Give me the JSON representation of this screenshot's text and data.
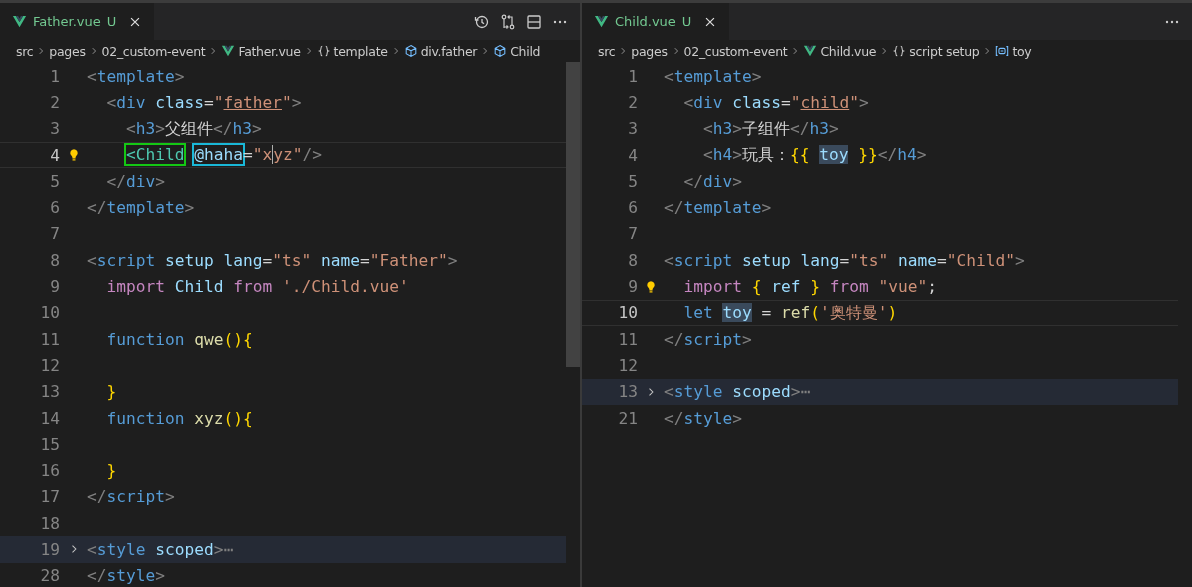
{
  "editors": [
    {
      "tab": {
        "label": "Father.vue",
        "status": "U",
        "selected": true
      },
      "toolbar": [
        {
          "kind": "history"
        },
        {
          "kind": "compare"
        },
        {
          "kind": "split"
        },
        {
          "kind": "more"
        }
      ],
      "breadcrumbs": [
        {
          "label": "src",
          "kind": "folder"
        },
        {
          "label": "pages",
          "kind": "folder"
        },
        {
          "label": "02_custom-event",
          "kind": "folder"
        },
        {
          "label": "Father.vue",
          "kind": "vue"
        },
        {
          "label": "template",
          "kind": "braces"
        },
        {
          "label": "div.father",
          "kind": "element"
        },
        {
          "label": "Child",
          "kind": "element"
        }
      ],
      "lines": [
        {
          "n": "1",
          "tokens": [
            {
              "t": "<",
              "kind": "punct"
            },
            {
              "t": "template",
              "kind": "tag"
            },
            {
              "t": ">",
              "kind": "punct"
            }
          ]
        },
        {
          "n": "2",
          "tokens": [
            {
              "t": "  <",
              "kind": "punct"
            },
            {
              "t": "div",
              "kind": "tag"
            },
            {
              "t": " class",
              "kind": "attr"
            },
            {
              "t": "=",
              "kind": "text"
            },
            {
              "t": "\"",
              "kind": "str"
            },
            {
              "t": "father",
              "kind": "str",
              "underline": true
            },
            {
              "t": "\"",
              "kind": "str"
            },
            {
              "t": ">",
              "kind": "punct"
            }
          ]
        },
        {
          "n": "3",
          "tokens": [
            {
              "t": "    <",
              "kind": "punct"
            },
            {
              "t": "h3",
              "kind": "tag"
            },
            {
              "t": ">",
              "kind": "punct"
            },
            {
              "t": "父组件",
              "kind": "text"
            },
            {
              "t": "</",
              "kind": "punct"
            },
            {
              "t": "h3",
              "kind": "tag"
            },
            {
              "t": ">",
              "kind": "punct"
            }
          ]
        },
        {
          "n": "4",
          "current": true,
          "lightbulb": true,
          "tokens": [
            {
              "t": "    <Child",
              "kind": "component",
              "color": "#14c814"
            },
            {
              "t": " @haha",
              "kind": "attr",
              "color": "#1ab8d8"
            },
            {
              "t": "=",
              "kind": "text"
            },
            {
              "t": "\"x",
              "kind": "str",
              "caret": true
            },
            {
              "t": "yz\"",
              "kind": "str"
            },
            {
              "t": "/>",
              "kind": "punct"
            }
          ]
        },
        {
          "n": "5",
          "tokens": [
            {
              "t": "  </",
              "kind": "punct"
            },
            {
              "t": "div",
              "kind": "tag"
            },
            {
              "t": ">",
              "kind": "punct"
            }
          ]
        },
        {
          "n": "6",
          "tokens": [
            {
              "t": "</",
              "kind": "punct"
            },
            {
              "t": "template",
              "kind": "tag"
            },
            {
              "t": ">",
              "kind": "punct"
            }
          ]
        },
        {
          "n": "7"
        },
        {
          "n": "8",
          "tokens": [
            {
              "t": "<",
              "kind": "punct"
            },
            {
              "t": "script",
              "kind": "tag"
            },
            {
              "t": " setup lang",
              "kind": "attr"
            },
            {
              "t": "=",
              "kind": "text"
            },
            {
              "t": "\"ts\"",
              "kind": "str"
            },
            {
              "t": " name",
              "kind": "attr"
            },
            {
              "t": "=",
              "kind": "text"
            },
            {
              "t": "\"Father\"",
              "kind": "str"
            },
            {
              "t": ">",
              "kind": "punct"
            }
          ]
        },
        {
          "n": "9",
          "tokens": [
            {
              "t": "  import",
              "kind": "keyword"
            },
            {
              "t": " Child ",
              "kind": "attr"
            },
            {
              "t": "from",
              "kind": "keyword"
            },
            {
              "t": " './Child.vue'",
              "kind": "str"
            }
          ]
        },
        {
          "n": "10"
        },
        {
          "n": "11",
          "tokens": [
            {
              "t": "  function",
              "kind": "tag"
            },
            {
              "t": " qwe",
              "kind": "func"
            },
            {
              "t": "(){",
              "kind": "bracket"
            }
          ]
        },
        {
          "n": "12"
        },
        {
          "n": "13",
          "tokens": [
            {
              "t": "  }",
              "kind": "bracket"
            }
          ]
        },
        {
          "n": "14",
          "tokens": [
            {
              "t": "  function",
              "kind": "tag"
            },
            {
              "t": " xyz",
              "kind": "func"
            },
            {
              "t": "(){",
              "kind": "bracket"
            }
          ]
        },
        {
          "n": "15"
        },
        {
          "n": "16",
          "tokens": [
            {
              "t": "  }",
              "kind": "bracket"
            }
          ]
        },
        {
          "n": "17",
          "tokens": [
            {
              "t": "</",
              "kind": "punct"
            },
            {
              "t": "script",
              "kind": "tag"
            },
            {
              "t": ">",
              "kind": "punct"
            }
          ]
        },
        {
          "n": "18"
        },
        {
          "n": "19",
          "folded": true,
          "tokens": [
            {
              "t": "<",
              "kind": "punct"
            },
            {
              "t": "style",
              "kind": "tag"
            },
            {
              "t": " scoped",
              "kind": "attr"
            },
            {
              "t": ">",
              "kind": "punct"
            },
            {
              "t": "⋯",
              "kind": "punct"
            }
          ]
        },
        {
          "n": "28",
          "tokens": [
            {
              "t": "</",
              "kind": "punct"
            },
            {
              "t": "style",
              "kind": "tag"
            },
            {
              "t": ">",
              "kind": "punct"
            }
          ]
        }
      ]
    },
    {
      "tab": {
        "label": "Child.vue",
        "status": "U",
        "selected": true
      },
      "toolbar": [
        {
          "kind": "more"
        }
      ],
      "breadcrumbs": [
        {
          "label": "src",
          "kind": "folder"
        },
        {
          "label": "pages",
          "kind": "folder"
        },
        {
          "label": "02_custom-event",
          "kind": "folder"
        },
        {
          "label": "Child.vue",
          "kind": "vue"
        },
        {
          "label": "script setup",
          "kind": "braces"
        },
        {
          "label": "toy",
          "kind": "variable"
        }
      ],
      "lines": [
        {
          "n": "1",
          "tokens": [
            {
              "t": "<",
              "kind": "punct"
            },
            {
              "t": "template",
              "kind": "tag"
            },
            {
              "t": ">",
              "kind": "punct"
            }
          ]
        },
        {
          "n": "2",
          "tokens": [
            {
              "t": "  <",
              "kind": "punct"
            },
            {
              "t": "div",
              "kind": "tag"
            },
            {
              "t": " class",
              "kind": "attr"
            },
            {
              "t": "=",
              "kind": "text"
            },
            {
              "t": "\"",
              "kind": "str"
            },
            {
              "t": "child",
              "kind": "str",
              "underline": true
            },
            {
              "t": "\"",
              "kind": "str"
            },
            {
              "t": ">",
              "kind": "punct"
            }
          ]
        },
        {
          "n": "3",
          "tokens": [
            {
              "t": "    <",
              "kind": "punct"
            },
            {
              "t": "h3",
              "kind": "tag"
            },
            {
              "t": ">",
              "kind": "punct"
            },
            {
              "t": "子组件",
              "kind": "text"
            },
            {
              "t": "</",
              "kind": "punct"
            },
            {
              "t": "h3",
              "kind": "tag"
            },
            {
              "t": ">",
              "kind": "punct"
            }
          ]
        },
        {
          "n": "4",
          "tokens": [
            {
              "t": "    <",
              "kind": "punct"
            },
            {
              "t": "h4",
              "kind": "tag"
            },
            {
              "t": ">",
              "kind": "punct"
            },
            {
              "t": "玩具：",
              "kind": "text"
            },
            {
              "t": "{{ ",
              "kind": "bracket"
            },
            {
              "t": "toy",
              "kind": "attr",
              "highlight": true
            },
            {
              "t": " }}",
              "kind": "bracket"
            },
            {
              "t": "</",
              "kind": "punct"
            },
            {
              "t": "h4",
              "kind": "tag"
            },
            {
              "t": ">",
              "kind": "punct"
            }
          ]
        },
        {
          "n": "5",
          "tokens": [
            {
              "t": "  </",
              "kind": "punct"
            },
            {
              "t": "div",
              "kind": "tag"
            },
            {
              "t": ">",
              "kind": "punct"
            }
          ]
        },
        {
          "n": "6",
          "tokens": [
            {
              "t": "</",
              "kind": "punct"
            },
            {
              "t": "template",
              "kind": "tag"
            },
            {
              "t": ">",
              "kind": "punct"
            }
          ]
        },
        {
          "n": "7"
        },
        {
          "n": "8",
          "tokens": [
            {
              "t": "<",
              "kind": "punct"
            },
            {
              "t": "script",
              "kind": "tag"
            },
            {
              "t": " setup lang",
              "kind": "attr"
            },
            {
              "t": "=",
              "kind": "text"
            },
            {
              "t": "\"ts\"",
              "kind": "str"
            },
            {
              "t": " name",
              "kind": "attr"
            },
            {
              "t": "=",
              "kind": "text"
            },
            {
              "t": "\"Child\"",
              "kind": "str"
            },
            {
              "t": ">",
              "kind": "punct"
            }
          ]
        },
        {
          "n": "9",
          "lightbulb": true,
          "tokens": [
            {
              "t": "  import",
              "kind": "keyword"
            },
            {
              "t": " {",
              "kind": "bracket"
            },
            {
              "t": " ref ",
              "kind": "attr"
            },
            {
              "t": "}",
              "kind": "bracket"
            },
            {
              "t": " from",
              "kind": "keyword"
            },
            {
              "t": " \"vue\"",
              "kind": "str"
            },
            {
              "t": ";",
              "kind": "text"
            }
          ]
        },
        {
          "n": "10",
          "current": true,
          "tokens": [
            {
              "t": "  let ",
              "kind": "tag"
            },
            {
              "t": "toy",
              "kind": "attr",
              "highlight": true
            },
            {
              "t": " = ",
              "kind": "text"
            },
            {
              "t": "ref",
              "kind": "func"
            },
            {
              "t": "(",
              "kind": "bracket"
            },
            {
              "t": "'奥特曼'",
              "kind": "str"
            },
            {
              "t": ")",
              "kind": "bracket"
            }
          ]
        },
        {
          "n": "11",
          "tokens": [
            {
              "t": "</",
              "kind": "punct"
            },
            {
              "t": "script",
              "kind": "tag"
            },
            {
              "t": ">",
              "kind": "punct"
            }
          ]
        },
        {
          "n": "12"
        },
        {
          "n": "13",
          "folded": true,
          "tokens": [
            {
              "t": "<",
              "kind": "punct"
            },
            {
              "t": "style",
              "kind": "tag"
            },
            {
              "t": " scoped",
              "kind": "attr"
            },
            {
              "t": ">",
              "kind": "punct"
            },
            {
              "t": "⋯",
              "kind": "punct"
            }
          ]
        },
        {
          "n": "21",
          "tokens": [
            {
              "t": "</",
              "kind": "punct"
            },
            {
              "t": "style",
              "kind": "tag"
            },
            {
              "t": ">",
              "kind": "punct"
            }
          ]
        }
      ]
    }
  ]
}
